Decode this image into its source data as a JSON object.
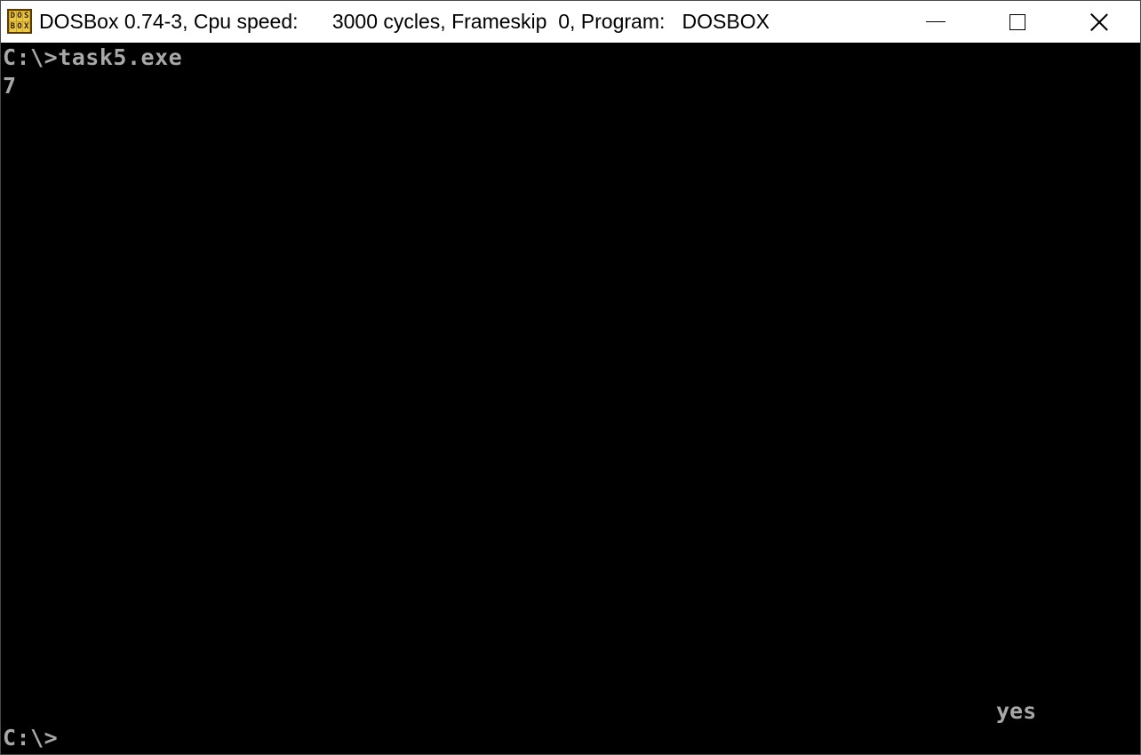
{
  "window": {
    "title": "DOSBox 0.74-3, Cpu speed:      3000 cycles, Frameskip  0, Program:   DOSBOX",
    "icon": {
      "name": "dosbox-icon",
      "letters": [
        "D",
        "O",
        "S",
        "B",
        "O",
        "X"
      ]
    },
    "controls": {
      "minimize": "minimize-icon",
      "maximize": "maximize-icon",
      "close": "close-icon"
    }
  },
  "console": {
    "lines": [
      "C:\\>task5.exe",
      "7"
    ],
    "output_right": "yes",
    "prompt": "C:\\>"
  },
  "colors": {
    "background": "#000000",
    "text": "#a8a8a8",
    "titlebar": "#ffffff"
  }
}
